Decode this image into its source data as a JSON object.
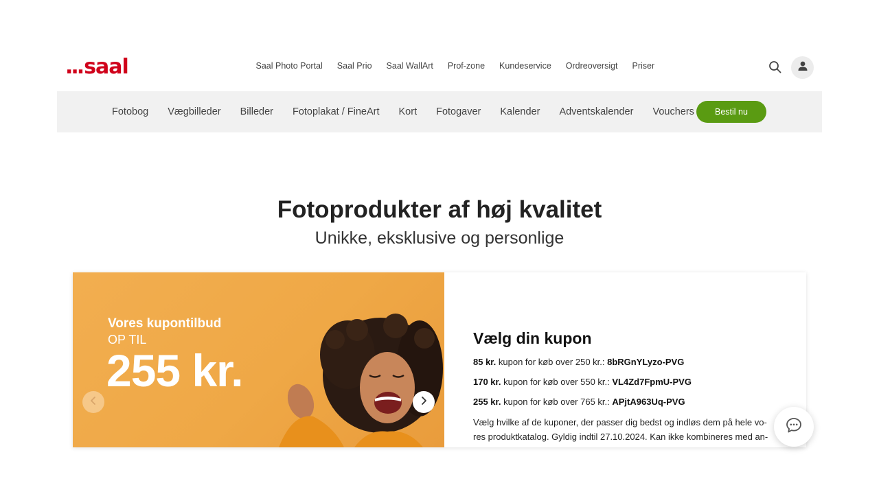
{
  "brand": {
    "logo_dots": "...",
    "logo_text": "saal",
    "accent": "#d0021b"
  },
  "topnav": {
    "items": [
      "Saal Photo Portal",
      "Saal Prio",
      "Saal WallArt",
      "Prof-zone",
      "Kundeservice",
      "Ordreoversigt",
      "Priser"
    ],
    "search_icon": "search-icon",
    "user_icon": "user-icon"
  },
  "catnav": {
    "items": [
      "Fotobog",
      "Vægbilleder",
      "Billeder",
      "Fotoplakat / FineArt",
      "Kort",
      "Fotogaver",
      "Kalender",
      "Adventskalender",
      "Vouchers"
    ],
    "order_button": "Bestil nu",
    "order_button_color": "#5a9b12"
  },
  "hero": {
    "title": "Fotoprodukter af høj kvalitet",
    "subtitle": "Unikke, eksklusive og personlige"
  },
  "promo": {
    "title": "Vores kupontilbud",
    "upto": "OP TIL",
    "amount": "255 kr.",
    "background": "#efa846",
    "prev_icon": "chevron-left-icon",
    "next_icon": "chevron-right-icon"
  },
  "coupons": {
    "heading": "Vælg din kupon",
    "items": [
      {
        "amount": "85 kr.",
        "text": " kupon for køb over 250 kr.: ",
        "code": "8bRGnYLyzo-PVG"
      },
      {
        "amount": "170 kr.",
        "text": " kupon for køb over 550 kr.: ",
        "code": "VL4Zd7FpmU-PVG"
      },
      {
        "amount": "255 kr.",
        "text": " kupon for køb over 765 kr.: ",
        "code": "APjtA963Uq-PVG"
      }
    ],
    "description": "Vælg hvilke af de kuponer, der passer dig bedst og indløs dem på hele vo-res produktkatalog. Gyldig indtil 27.10.2024. Kan ikke kombineres med an-"
  },
  "chat": {
    "icon": "chat-icon"
  }
}
